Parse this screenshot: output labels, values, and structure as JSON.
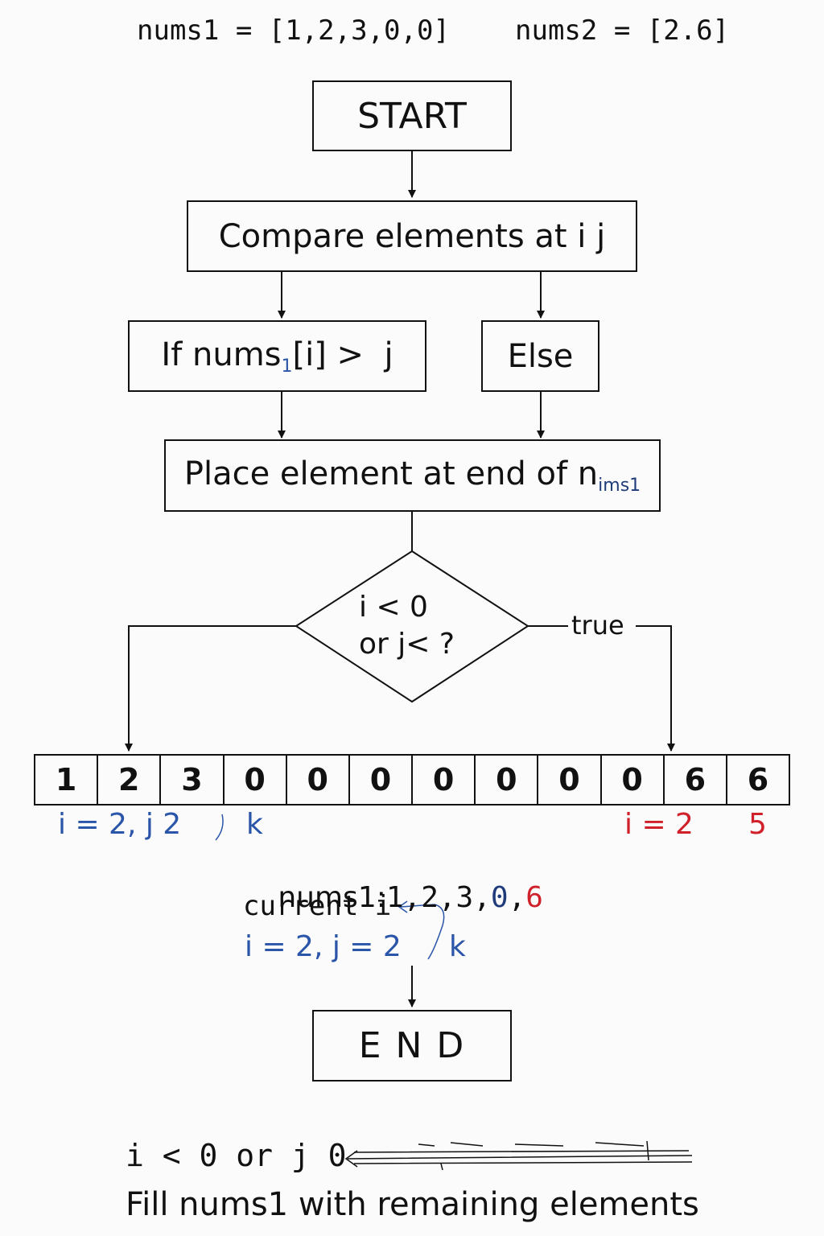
{
  "header": {
    "nums1_label": "nums1 = [1,2,3,0,0]",
    "nums2_label": "nums2 = [2.6]"
  },
  "nodes": {
    "start": "START",
    "compare": "Compare elements at i  j",
    "if_prefix": "If nums",
    "if_sub": "1",
    "if_bracket": "[i]",
    "if_suffix": " >  j",
    "else": "Else",
    "place_prefix": "Place element at end of n",
    "place_sub": "ims1",
    "decision_line1": "i < 0",
    "decision_line2": "or j< ?",
    "true_label": "true",
    "end": "E N D"
  },
  "array": {
    "cells": [
      "1",
      "2",
      "3",
      "0",
      "0",
      "0",
      "0",
      "0",
      "0",
      "0",
      "6",
      "6"
    ]
  },
  "annotations": {
    "left_pointer": "i = 2, j 2",
    "k_marker": "k",
    "right_pointer": "i = 2",
    "right_value": "5",
    "nums1_prefix": "nums1:",
    "nums1_values_black": "1,2,3,",
    "nums1_value_blue": "0",
    "nums1_comma": ",",
    "nums1_value_red": "6",
    "current_i": "current i",
    "state_line": "i = 2, j = 2",
    "state_k": "k"
  },
  "footer": {
    "condition": "i < 0 or j 0",
    "action": "Fill nums1 with remaining elements"
  },
  "colors": {
    "line": "#111111",
    "blue": "#2a55a8",
    "red": "#d0202a",
    "navy": "#1f3b7a"
  }
}
